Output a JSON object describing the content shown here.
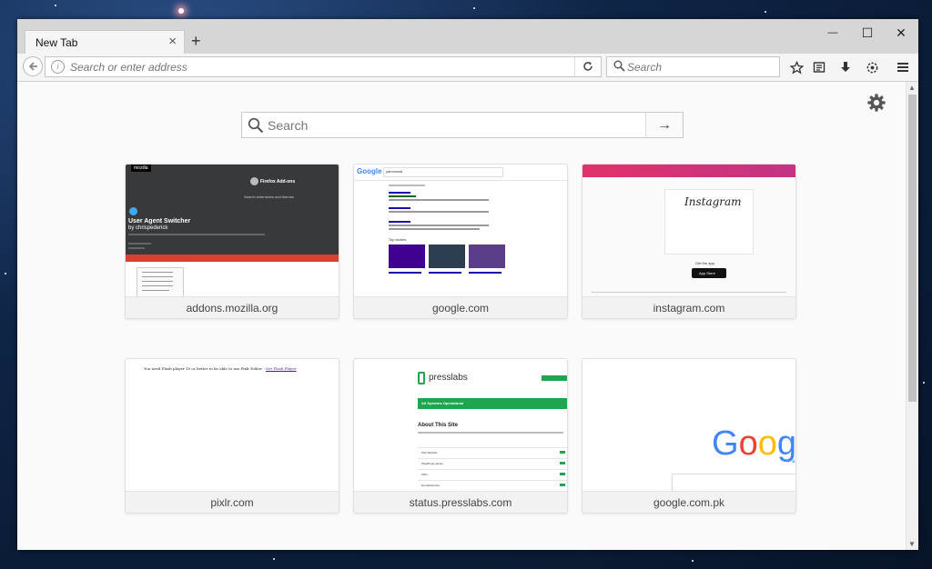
{
  "browser": {
    "tab": {
      "title": "New Tab",
      "close_glyph": "×"
    },
    "new_tab_glyph": "+",
    "window_controls": {
      "minimize": "—",
      "maximize": "☐",
      "close": "✕"
    },
    "address_bar": {
      "placeholder": "Search or enter address"
    },
    "search_bar": {
      "placeholder": "Search"
    },
    "toolbar_icons": [
      "bookmark-star-icon",
      "reading-list-icon",
      "downloads-icon",
      "addons-icon",
      "hamburger-menu-icon"
    ]
  },
  "newtab": {
    "search_placeholder": "Search",
    "go_glyph": "→",
    "tiles": [
      {
        "label": "addons.mozilla.org"
      },
      {
        "label": "google.com"
      },
      {
        "label": "instagram.com"
      },
      {
        "label": "pixlr.com"
      },
      {
        "label": "status.presslabs.com"
      },
      {
        "label": "google.com.pk"
      }
    ]
  },
  "thumbnails": {
    "amo": {
      "brand": "mozilla",
      "header": "Firefox Add-ons",
      "search": "Search extensions and themes",
      "title": "User Agent Switcher",
      "author": "by chrispederick"
    },
    "google": {
      "logo": "Google",
      "query": "yahoomail",
      "top_stories": "Top stories"
    },
    "instagram": {
      "logo": "Instagram",
      "get_app": "Get the app.",
      "app_store": "App Store"
    },
    "pixlr": {
      "notice": "You need Flash player 10 or better to be able to use Pixlr Editor - ",
      "link": "Get Flash Player"
    },
    "presslabs": {
      "logo": "presslabs",
      "status": "All Systems Operational",
      "about": "About This Site",
      "rows": [
        "Pixlr Website",
        "WordPress admin",
        "CDN",
        "DomainService"
      ]
    },
    "google_pk": {
      "logo": "Googl",
      "sub": "Pa"
    }
  },
  "colors": {
    "accent_red": "#d7412f",
    "instagram_pink": "#e0326a",
    "presslabs_green": "#1fa550",
    "amo_dark": "#38393a"
  }
}
